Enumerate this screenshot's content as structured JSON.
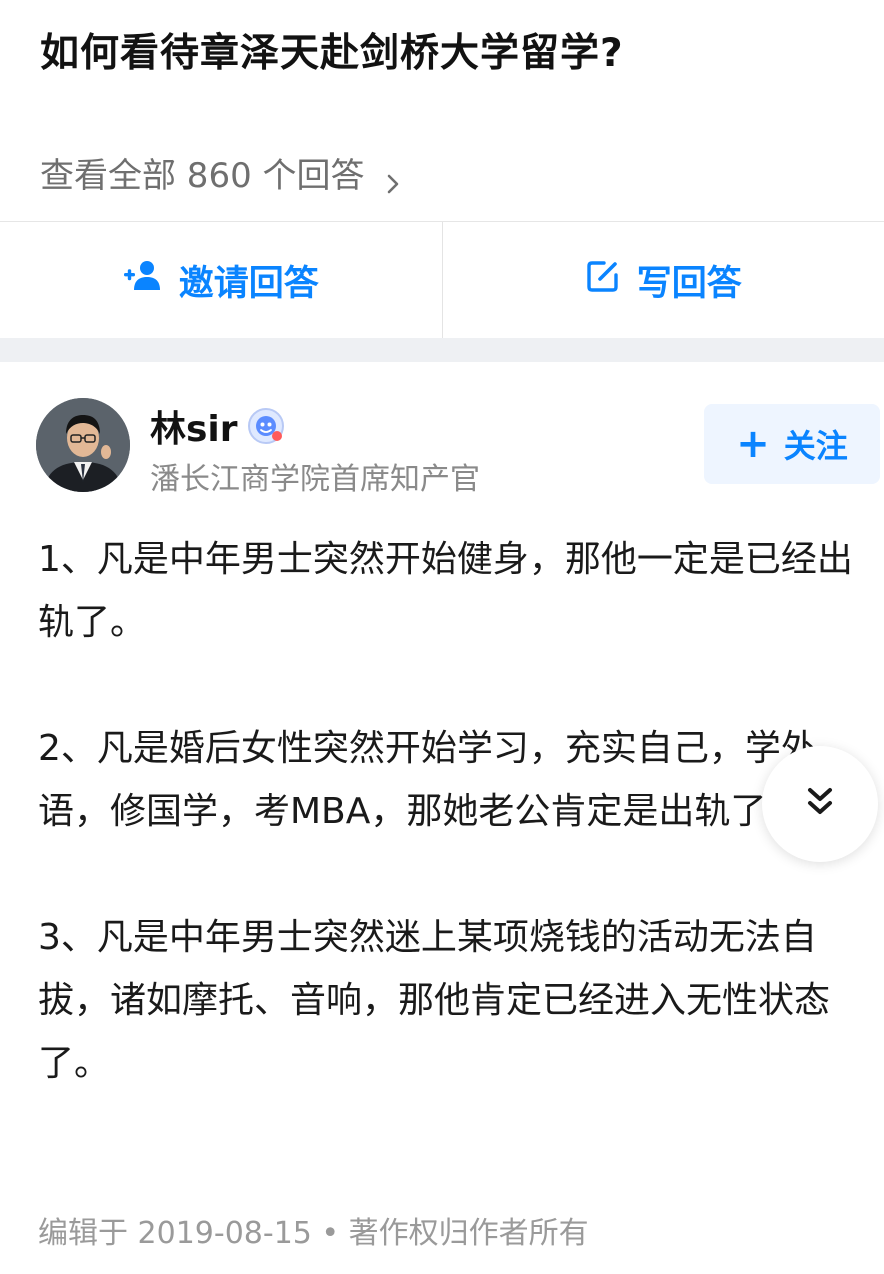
{
  "question": {
    "title": "如何看待章泽天赴剑桥大学留学?",
    "view_all_label": "查看全部 860 个回答"
  },
  "actions": {
    "invite_label": "邀请回答",
    "write_label": "写回答"
  },
  "answer": {
    "author": {
      "name": "林sir",
      "description": "潘长江商学院首席知产官"
    },
    "follow_label": "关注",
    "paragraphs": [
      "1、凡是中年男士突然开始健身，那他一定是已经出轨了。",
      "2、凡是婚后女性突然开始学习，充实自己，学外语，修国学，考MBA，那她老公肯定是出轨了。",
      "3、凡是中年男士突然迷上某项烧钱的活动无法自拔，诸如摩托、音响，那他肯定已经进入无性状态了。"
    ],
    "footer": "编辑于 2019-08-15 • 著作权归作者所有"
  },
  "colors": {
    "accent": "#0a84ff",
    "muted_text": "#8a8a8a",
    "divider_band": "#eef0f3"
  },
  "icons": {
    "view_all": "chevron-right-icon",
    "invite": "add-user-icon",
    "write": "edit-icon",
    "badge": "verified-badge-icon",
    "expand": "double-chevron-down-icon"
  }
}
